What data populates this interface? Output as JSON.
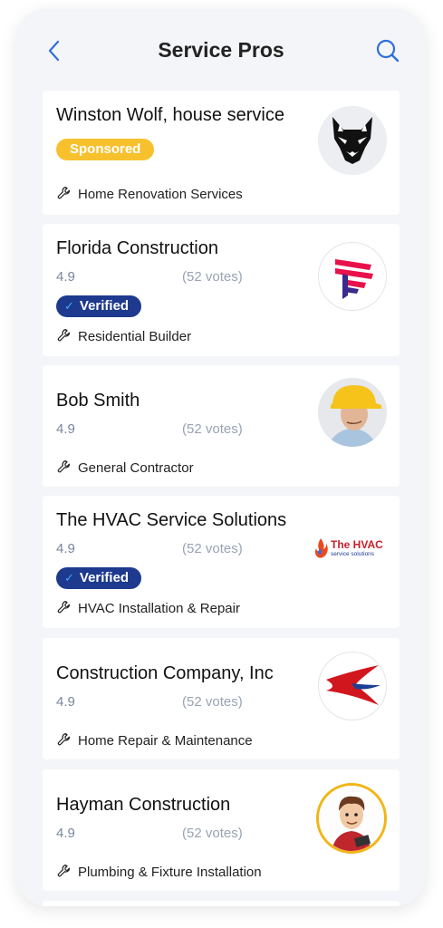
{
  "header": {
    "title": "Service Pros",
    "back_icon": "chevron-left-icon",
    "search_icon": "search-icon"
  },
  "colors": {
    "accent": "#2f6fdc",
    "sponsored": "#f7c12e",
    "verified": "#1e3a8f"
  },
  "pros": [
    {
      "name": "Winston Wolf, house service",
      "badge": "Sponsored",
      "category": "Home Renovation Services",
      "logo": "wolf-logo"
    },
    {
      "name": "Florida Construction",
      "rating": "4.9",
      "votes": "(52 votes)",
      "badge": "Verified",
      "category": "Residential Builder",
      "logo": "latam-f-logo"
    },
    {
      "name": "Bob Smith",
      "rating": "4.9",
      "votes": "(52 votes)",
      "category": "General Contractor",
      "logo": "worker-photo"
    },
    {
      "name": "The HVAC Service Solutions",
      "rating": "4.9",
      "votes": "(52 votes)",
      "badge": "Verified",
      "category": "HVAC Installation & Repair",
      "logo": "hvac-logo",
      "logo_text": "The HVAC",
      "logo_subtext": "service solutions"
    },
    {
      "name": "Construction Company, Inc",
      "rating": "4.9",
      "votes": "(52 votes)",
      "category": "Home Repair & Maintenance",
      "logo": "swallow-logo"
    },
    {
      "name": "Hayman Construction",
      "rating": "4.9",
      "votes": "(52 votes)",
      "category": "Plumbing & Fixture Installation",
      "logo": "cartoon-avatar"
    }
  ]
}
